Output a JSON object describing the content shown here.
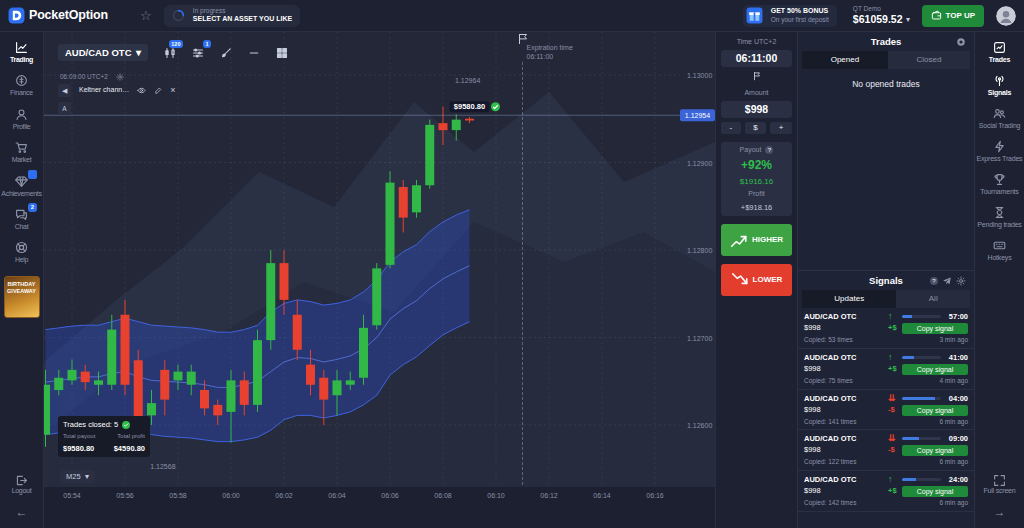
{
  "header": {
    "logo": "PocketOption",
    "star": "☆",
    "progress": {
      "status": "In progress",
      "task": "SELECT AN ASSET YOU LIKE"
    },
    "bonus": {
      "title": "GET 50% BONUS",
      "subtitle": "On your first deposit"
    },
    "account": {
      "type": "QT Demo",
      "balance": "$61059.52",
      "caret": "▾"
    },
    "top_up": "TOP UP"
  },
  "left_nav": {
    "items": [
      {
        "label": "Trading",
        "selected": true,
        "notified": false,
        "badge": null
      },
      {
        "label": "Finance",
        "selected": false,
        "notified": false,
        "badge": null
      },
      {
        "label": "Profile",
        "selected": false,
        "notified": false,
        "badge": null
      },
      {
        "label": "Market",
        "selected": false,
        "notified": false,
        "badge": null
      },
      {
        "label": "Achievements",
        "selected": false,
        "notified": true,
        "badge": null
      },
      {
        "label": "Chat",
        "selected": false,
        "notified": true,
        "badge": "2"
      },
      {
        "label": "Help",
        "selected": false,
        "notified": false,
        "badge": null
      }
    ],
    "promo": "BIRTHDAY GIVEAWAY",
    "logout": "Logout",
    "collapse": "←"
  },
  "chart": {
    "asset": "AUD/CAD OTC",
    "asset_caret": "▾",
    "tools": [
      {
        "badge": "120"
      },
      {
        "badge": "1"
      },
      {
        "badge": null
      },
      {
        "badge": null
      },
      {
        "badge": null
      }
    ],
    "clock": "06:09:00 UTC+2",
    "indicator": {
      "collapse": "◀",
      "label": "Keltner chann…",
      "close": "×"
    },
    "marker_label": "A",
    "expiration": {
      "label": "Expiration time",
      "time": "06:11:00"
    },
    "price_ticks": [
      "1.13000",
      "1.12900",
      "1.12800",
      "1.12700",
      "1.12600"
    ],
    "time_ticks": [
      "05:54",
      "05:56",
      "05:58",
      "06:00",
      "06:02",
      "06:04",
      "06:06",
      "06:08",
      "06:10",
      "06:12",
      "06:14",
      "06:16"
    ],
    "current_price": "1.12954",
    "high_label": "1.12964",
    "low_label": "1.12568",
    "candles": [
      {
        "o": 1.12589,
        "h": 1.12663,
        "l": 1.12575,
        "c": 1.12646
      },
      {
        "o": 1.1264,
        "h": 1.12663,
        "l": 1.12634,
        "c": 1.12654
      },
      {
        "o": 1.12651,
        "h": 1.12675,
        "l": 1.12646,
        "c": 1.12663
      },
      {
        "o": 1.12661,
        "h": 1.12669,
        "l": 1.1264,
        "c": 1.12649
      },
      {
        "o": 1.12646,
        "h": 1.12661,
        "l": 1.12634,
        "c": 1.12651
      },
      {
        "o": 1.12646,
        "h": 1.12726,
        "l": 1.1264,
        "c": 1.12709
      },
      {
        "o": 1.12726,
        "h": 1.12743,
        "l": 1.12634,
        "c": 1.12646
      },
      {
        "o": 1.12674,
        "h": 1.12686,
        "l": 1.12568,
        "c": 1.12585
      },
      {
        "o": 1.12611,
        "h": 1.1264,
        "l": 1.126,
        "c": 1.12625
      },
      {
        "o": 1.12663,
        "h": 1.12674,
        "l": 1.12611,
        "c": 1.12629
      },
      {
        "o": 1.12651,
        "h": 1.12669,
        "l": 1.1264,
        "c": 1.12661
      },
      {
        "o": 1.12646,
        "h": 1.12669,
        "l": 1.12634,
        "c": 1.12661
      },
      {
        "o": 1.1264,
        "h": 1.12651,
        "l": 1.12611,
        "c": 1.12619
      },
      {
        "o": 1.12623,
        "h": 1.12629,
        "l": 1.126,
        "c": 1.12611
      },
      {
        "o": 1.12615,
        "h": 1.12663,
        "l": 1.1258,
        "c": 1.12651
      },
      {
        "o": 1.12651,
        "h": 1.12661,
        "l": 1.12611,
        "c": 1.12623
      },
      {
        "o": 1.12623,
        "h": 1.12709,
        "l": 1.12615,
        "c": 1.12697
      },
      {
        "o": 1.12697,
        "h": 1.128,
        "l": 1.12686,
        "c": 1.12785
      },
      {
        "o": 1.12785,
        "h": 1.128,
        "l": 1.12726,
        "c": 1.12743
      },
      {
        "o": 1.12726,
        "h": 1.12743,
        "l": 1.12674,
        "c": 1.12686
      },
      {
        "o": 1.12669,
        "h": 1.12686,
        "l": 1.12634,
        "c": 1.12646
      },
      {
        "o": 1.12654,
        "h": 1.12663,
        "l": 1.126,
        "c": 1.12629
      },
      {
        "o": 1.12634,
        "h": 1.12663,
        "l": 1.12611,
        "c": 1.12651
      },
      {
        "o": 1.12646,
        "h": 1.12661,
        "l": 1.1264,
        "c": 1.12651
      },
      {
        "o": 1.12654,
        "h": 1.12726,
        "l": 1.12646,
        "c": 1.12711
      },
      {
        "o": 1.12714,
        "h": 1.12785,
        "l": 1.12709,
        "c": 1.12779
      },
      {
        "o": 1.12783,
        "h": 1.1289,
        "l": 1.12779,
        "c": 1.12877
      },
      {
        "o": 1.12872,
        "h": 1.1288,
        "l": 1.1282,
        "c": 1.12837
      },
      {
        "o": 1.12843,
        "h": 1.1288,
        "l": 1.12837,
        "c": 1.12874
      },
      {
        "o": 1.12874,
        "h": 1.12949,
        "l": 1.1287,
        "c": 1.12943
      },
      {
        "o": 1.12945,
        "h": 1.12964,
        "l": 1.1292,
        "c": 1.12937
      },
      {
        "o": 1.12937,
        "h": 1.12955,
        "l": 1.12925,
        "c": 1.12949
      },
      {
        "o": 1.1295,
        "h": 1.12952,
        "l": 1.12945,
        "c": 1.12948
      }
    ],
    "keltner": {
      "upper": [
        1.12709,
        1.12711,
        1.12713,
        1.12714,
        1.12714,
        1.12718,
        1.12722,
        1.12718,
        1.12714,
        1.12713,
        1.12712,
        1.12711,
        1.12709,
        1.12706,
        1.12706,
        1.12709,
        1.12714,
        1.12729,
        1.12739,
        1.12743,
        1.12741,
        1.12737,
        1.12739,
        1.12743,
        1.12752,
        1.12766,
        1.12786,
        1.12798,
        1.12806,
        1.12821,
        1.12832,
        1.1284,
        1.12846
      ],
      "middle": [
        1.12649,
        1.12651,
        1.12653,
        1.12655,
        1.12655,
        1.12659,
        1.12661,
        1.12655,
        1.12651,
        1.1265,
        1.12649,
        1.12648,
        1.12646,
        1.12643,
        1.12643,
        1.12646,
        1.1265,
        1.12661,
        1.12672,
        1.12677,
        1.12676,
        1.12672,
        1.12675,
        1.12679,
        1.12687,
        1.127,
        1.12721,
        1.12733,
        1.12742,
        1.12756,
        1.12767,
        1.12775,
        1.12782
      ],
      "lower": [
        1.12589,
        1.12591,
        1.12594,
        1.12597,
        1.12597,
        1.126,
        1.126,
        1.12592,
        1.12589,
        1.12587,
        1.12586,
        1.12585,
        1.12583,
        1.12581,
        1.12581,
        1.12583,
        1.12586,
        1.12594,
        1.12606,
        1.12611,
        1.12611,
        1.12608,
        1.12611,
        1.12615,
        1.12623,
        1.12634,
        1.12657,
        1.12669,
        1.12678,
        1.12691,
        1.12703,
        1.12711,
        1.12718
      ]
    },
    "trade_marker": {
      "amount": "$9580.80",
      "won": true
    },
    "trades_closed": {
      "title": "Trades closed: 5",
      "won": true,
      "payout_label": "Total payout",
      "profit_label": "Total profit",
      "payout": "$9580.80",
      "profit": "$4590.80"
    },
    "timeframe": "M25",
    "timeframe_caret": "▾"
  },
  "trade_panel": {
    "time_label": "Time UTC+2",
    "time": "06:11:00",
    "amount_label": "Amount",
    "amount": "$998",
    "amount_buttons": [
      "-",
      "$",
      "+"
    ],
    "payout": {
      "label": "Payout",
      "help": "?",
      "percent": "+92%",
      "value": "$1916.16",
      "profit_label": "Profit",
      "profit": "+$918.16"
    },
    "higher": "HIGHER",
    "lower": "LOWER"
  },
  "trades": {
    "title": "Trades",
    "tabs": [
      {
        "label": "Opened",
        "selected": true
      },
      {
        "label": "Closed",
        "selected": false
      }
    ],
    "empty": "No opened trades"
  },
  "signals": {
    "title": "Signals",
    "help": "?",
    "tabs": [
      {
        "label": "Updates",
        "selected": true
      },
      {
        "label": "All",
        "selected": false
      }
    ],
    "items": [
      {
        "asset": "AUD/CAD OTC",
        "arrow": "↑",
        "amount": "$998",
        "sign": "+$",
        "time": "57:00",
        "level": 0.25,
        "button": "Copy signal",
        "copied": "Copied: 53 times",
        "ago": "3 min ago",
        "color": "#2fbf4a"
      },
      {
        "asset": "AUD/CAD OTC",
        "arrow": "↑",
        "amount": "$998",
        "sign": "+$",
        "time": "41:00",
        "level": 0.3,
        "button": "Copy signal",
        "copied": "Copied: 75 times",
        "ago": "4 min ago",
        "color": "#2fbf4a"
      },
      {
        "asset": "AUD/CAD OTC",
        "arrow": "⇊",
        "amount": "$998",
        "sign": "-$",
        "time": "04:00",
        "level": 0.85,
        "button": "Copy signal",
        "copied": "Copied: 141 times",
        "ago": "6 min ago",
        "color": "#e8412f"
      },
      {
        "asset": "AUD/CAD OTC",
        "arrow": "⇊",
        "amount": "$998",
        "sign": "-$",
        "time": "09:00",
        "level": 0.45,
        "button": "Copy signal",
        "copied": "Copied: 122 times",
        "ago": "6 min ago",
        "color": "#e8412f"
      },
      {
        "asset": "AUD/CAD OTC",
        "arrow": "↑",
        "amount": "$998",
        "sign": "+$",
        "time": "24:00",
        "level": 0.35,
        "button": "Copy signal",
        "copied": "Copied: 142 times",
        "ago": "6 min ago",
        "color": "#2fbf4a"
      }
    ]
  },
  "right_nav": {
    "items": [
      {
        "label": "Trades",
        "selected": true
      },
      {
        "label": "Signals",
        "selected": true
      },
      {
        "label": "Social Trading",
        "selected": false
      },
      {
        "label": "Express Trades",
        "selected": false
      },
      {
        "label": "Tournaments",
        "selected": false
      },
      {
        "label": "Pending trades",
        "selected": false
      },
      {
        "label": "Hotkeys",
        "selected": false
      }
    ],
    "fullscreen": "Full screen",
    "expand": "→"
  }
}
